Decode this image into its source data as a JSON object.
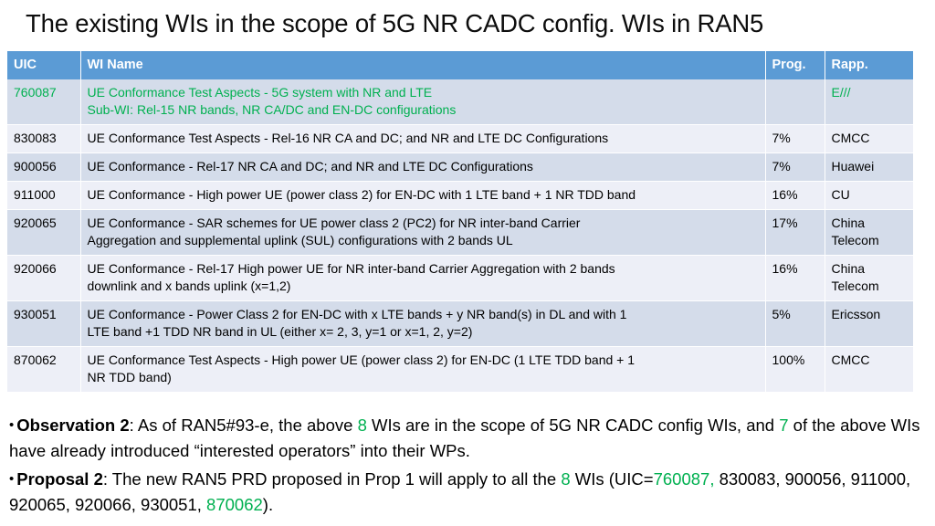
{
  "slide": {
    "title": "The existing WIs in the scope of 5G NR CADC config. WIs in RAN5"
  },
  "table": {
    "columns": {
      "uic": "UIC",
      "wi_name": "WI Name",
      "prog": "Prog.",
      "rapp": "Rapp."
    },
    "rows": [
      {
        "uic": "760087",
        "name_line1": "UE Conformance Test Aspects - 5G system with NR and LTE",
        "name_line2": "Sub-WI: Rel-15 NR bands, NR CA/DC and EN-DC configurations",
        "prog": "",
        "rapp": "E///",
        "highlight": "green",
        "band": "dark"
      },
      {
        "uic": "830083",
        "name_line1": "UE Conformance Test Aspects - Rel-16 NR CA and DC; and NR and LTE DC Configurations",
        "name_line2": "",
        "prog": "7%",
        "rapp": "CMCC",
        "highlight": "none",
        "band": "light"
      },
      {
        "uic": "900056",
        "name_line1": "UE Conformance - Rel-17 NR CA and DC; and NR and LTE DC Configurations",
        "name_line2": "",
        "prog": "7%",
        "rapp": "Huawei",
        "highlight": "none",
        "band": "dark"
      },
      {
        "uic": "911000",
        "name_line1": "UE Conformance - High power UE (power class 2) for EN-DC with 1 LTE band + 1 NR TDD band",
        "name_line2": "",
        "prog": "16%",
        "rapp": "CU",
        "highlight": "none",
        "band": "light"
      },
      {
        "uic": "920065",
        "name_line1": "UE Conformance - SAR schemes for UE power class 2 (PC2) for NR inter-band Carrier",
        "name_line2": "Aggregation and supplemental uplink (SUL) configurations with 2 bands UL",
        "prog": "17%",
        "rapp": "China Telecom",
        "highlight": "none",
        "band": "dark"
      },
      {
        "uic": "920066",
        "name_line1": "UE Conformance - Rel-17 High power UE for NR inter-band Carrier Aggregation with 2 bands",
        "name_line2": "downlink and x bands uplink (x=1,2)",
        "prog": "16%",
        "rapp": "China Telecom",
        "highlight": "none",
        "band": "light"
      },
      {
        "uic": "930051",
        "name_line1": "UE Conformance - Power Class 2 for EN-DC with x LTE bands + y NR band(s) in DL and with 1",
        "name_line2": "LTE band +1 TDD NR band in UL (either x= 2, 3, y=1 or x=1, 2, y=2)",
        "prog": "5%",
        "rapp": "Ericsson",
        "highlight": "none",
        "band": "dark"
      },
      {
        "uic": "870062",
        "name_line1": "UE Conformance Test Aspects - High power UE (power class 2) for EN-DC (1 LTE TDD band + 1",
        "name_line2": "NR TDD band)",
        "prog": "100%",
        "rapp": "CMCC",
        "highlight": "none",
        "band": "light"
      }
    ]
  },
  "bullets": {
    "observation": {
      "marker": "•",
      "label": "Observation 2",
      "part1": ": As of RAN5#93-e, the above ",
      "count1": "8",
      "part2": " WIs are in the scope of 5G NR CADC config WIs, and ",
      "count2": "7",
      "part3": " of the above WIs have already introduced “interested operators” into their WPs."
    },
    "proposal": {
      "marker": "•",
      "label": "Proposal 2",
      "part1": ": The new RAN5 PRD proposed in Prop 1 will apply to all the ",
      "count1": "8",
      "part2": " WIs (UIC=",
      "uic_first": "760087,",
      "uic_mid": " 830083, 900056, 911000, 920065, 920066, 930051, ",
      "uic_last": "870062",
      "part3": ")."
    }
  },
  "colors": {
    "header_blue": "#5B9BD5",
    "band_dark": "#D4DCEA",
    "band_light": "#EDEFF7",
    "accent_green": "#00B050"
  }
}
